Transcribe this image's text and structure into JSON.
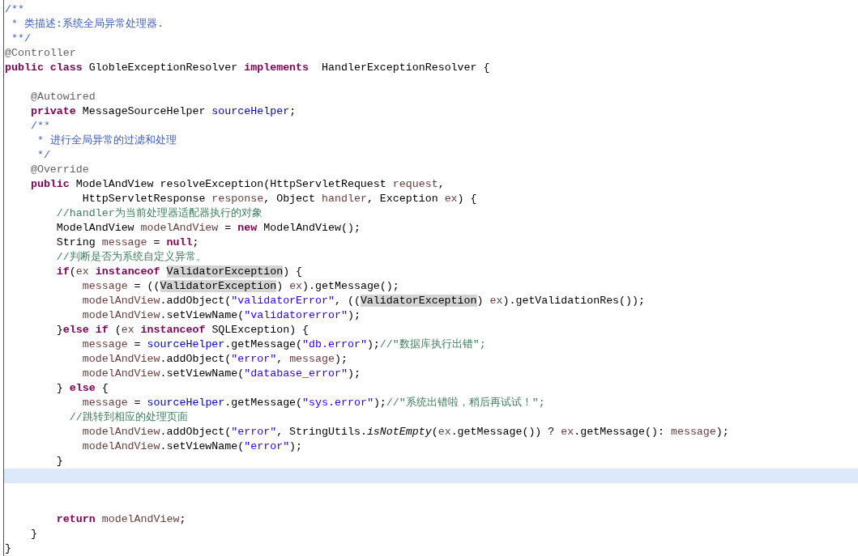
{
  "editor": {
    "lines": [
      {
        "current": false,
        "tokens": [
          {
            "kind": "doc",
            "text": "/**"
          }
        ]
      },
      {
        "current": false,
        "tokens": [
          {
            "kind": "doc",
            "text": " * 类描述:系统全局异常处理器."
          }
        ]
      },
      {
        "current": false,
        "tokens": [
          {
            "kind": "doc",
            "text": " **/"
          }
        ]
      },
      {
        "current": false,
        "tokens": [
          {
            "kind": "annotation",
            "text": "@Controller"
          }
        ]
      },
      {
        "current": false,
        "tokens": [
          {
            "kind": "keyword",
            "text": "public class"
          },
          {
            "kind": "plain",
            "text": " GlobleExceptionResolver "
          },
          {
            "kind": "keyword",
            "text": "implements"
          },
          {
            "kind": "plain",
            "text": "  HandlerExceptionResolver {"
          }
        ]
      },
      {
        "current": false
      },
      {
        "current": false,
        "tokens": [
          {
            "kind": "annotation",
            "text": "    @Autowired"
          }
        ]
      },
      {
        "current": false,
        "tokens": [
          {
            "kind": "keyword",
            "text": "    private"
          },
          {
            "kind": "plain",
            "text": " MessageSourceHelper "
          },
          {
            "kind": "field",
            "text": "sourceHelper"
          },
          {
            "kind": "plain",
            "text": ";"
          }
        ]
      },
      {
        "current": false,
        "tokens": [
          {
            "kind": "doc",
            "text": "    /**"
          }
        ]
      },
      {
        "current": false,
        "tokens": [
          {
            "kind": "doc",
            "text": "     * 进行全局异常的过滤和处理"
          }
        ]
      },
      {
        "current": false,
        "tokens": [
          {
            "kind": "doc",
            "text": "     */"
          }
        ]
      },
      {
        "current": false,
        "tokens": [
          {
            "kind": "annotation",
            "text": "    @Override"
          }
        ]
      },
      {
        "current": false,
        "tokens": [
          {
            "kind": "keyword",
            "text": "    public"
          },
          {
            "kind": "plain",
            "text": " ModelAndView resolveException(HttpServletRequest "
          },
          {
            "kind": "variable",
            "text": "request"
          },
          {
            "kind": "plain",
            "text": ","
          }
        ]
      },
      {
        "current": false,
        "tokens": [
          {
            "kind": "plain",
            "text": "            HttpServletResponse "
          },
          {
            "kind": "variable",
            "text": "response"
          },
          {
            "kind": "plain",
            "text": ", Object "
          },
          {
            "kind": "variable",
            "text": "handler"
          },
          {
            "kind": "plain",
            "text": ", Exception "
          },
          {
            "kind": "variable",
            "text": "ex"
          },
          {
            "kind": "plain",
            "text": ") {"
          }
        ]
      },
      {
        "current": false,
        "tokens": [
          {
            "kind": "comment",
            "text": "        //handler为当前处理器适配器执行的对象"
          }
        ]
      },
      {
        "current": false,
        "tokens": [
          {
            "kind": "plain",
            "text": "        ModelAndView "
          },
          {
            "kind": "variable",
            "text": "modelAndView"
          },
          {
            "kind": "plain",
            "text": " = "
          },
          {
            "kind": "keyword",
            "text": "new"
          },
          {
            "kind": "plain",
            "text": " ModelAndView();"
          }
        ]
      },
      {
        "current": false,
        "tokens": [
          {
            "kind": "plain",
            "text": "        String "
          },
          {
            "kind": "variable",
            "text": "message"
          },
          {
            "kind": "plain",
            "text": " = "
          },
          {
            "kind": "keyword",
            "text": "null"
          },
          {
            "kind": "plain",
            "text": ";"
          }
        ]
      },
      {
        "current": false,
        "tokens": [
          {
            "kind": "comment",
            "text": "        //判断是否为系统自定义异常。"
          }
        ]
      },
      {
        "current": false,
        "tokens": [
          {
            "kind": "keyword",
            "text": "        if"
          },
          {
            "kind": "plain",
            "text": "("
          },
          {
            "kind": "variable",
            "text": "ex"
          },
          {
            "kind": "keyword",
            "text": " instanceof "
          },
          {
            "kind": "occurrence",
            "text": "ValidatorException"
          },
          {
            "kind": "plain",
            "text": ") {"
          }
        ]
      },
      {
        "current": false,
        "tokens": [
          {
            "kind": "variable",
            "text": "            message"
          },
          {
            "kind": "plain",
            "text": " = (("
          },
          {
            "kind": "occurrence",
            "text": "ValidatorException"
          },
          {
            "kind": "plain",
            "text": ") "
          },
          {
            "kind": "variable",
            "text": "ex"
          },
          {
            "kind": "plain",
            "text": ").getMessage();"
          }
        ]
      },
      {
        "current": false,
        "tokens": [
          {
            "kind": "variable",
            "text": "            modelAndView"
          },
          {
            "kind": "plain",
            "text": ".addObject("
          },
          {
            "kind": "string",
            "text": "\"validatorError\""
          },
          {
            "kind": "plain",
            "text": ", (("
          },
          {
            "kind": "occurrence",
            "text": "ValidatorException"
          },
          {
            "kind": "plain",
            "text": ") "
          },
          {
            "kind": "variable",
            "text": "ex"
          },
          {
            "kind": "plain",
            "text": ").getValidationRes());"
          }
        ]
      },
      {
        "current": false,
        "tokens": [
          {
            "kind": "variable",
            "text": "            modelAndView"
          },
          {
            "kind": "plain",
            "text": ".setViewName("
          },
          {
            "kind": "string",
            "text": "\"validatorerror\""
          },
          {
            "kind": "plain",
            "text": ");"
          }
        ]
      },
      {
        "current": false,
        "tokens": [
          {
            "kind": "plain",
            "text": "        }"
          },
          {
            "kind": "keyword",
            "text": "else if"
          },
          {
            "kind": "plain",
            "text": " ("
          },
          {
            "kind": "variable",
            "text": "ex"
          },
          {
            "kind": "keyword",
            "text": " instanceof"
          },
          {
            "kind": "plain",
            "text": " SQLException) {"
          }
        ]
      },
      {
        "current": false,
        "tokens": [
          {
            "kind": "variable",
            "text": "            message"
          },
          {
            "kind": "plain",
            "text": " = "
          },
          {
            "kind": "field",
            "text": "sourceHelper"
          },
          {
            "kind": "plain",
            "text": ".getMessage("
          },
          {
            "kind": "string",
            "text": "\"db.error\""
          },
          {
            "kind": "plain",
            "text": ");"
          },
          {
            "kind": "comment",
            "text": "//\"数据库执行出错\";"
          }
        ]
      },
      {
        "current": false,
        "tokens": [
          {
            "kind": "variable",
            "text": "            modelAndView"
          },
          {
            "kind": "plain",
            "text": ".addObject("
          },
          {
            "kind": "string",
            "text": "\"error\""
          },
          {
            "kind": "plain",
            "text": ", "
          },
          {
            "kind": "variable",
            "text": "message"
          },
          {
            "kind": "plain",
            "text": ");"
          }
        ]
      },
      {
        "current": false,
        "tokens": [
          {
            "kind": "variable",
            "text": "            modelAndView"
          },
          {
            "kind": "plain",
            "text": ".setViewName("
          },
          {
            "kind": "string",
            "text": "\"database_error\""
          },
          {
            "kind": "plain",
            "text": ");"
          }
        ]
      },
      {
        "current": false,
        "tokens": [
          {
            "kind": "plain",
            "text": "        } "
          },
          {
            "kind": "keyword",
            "text": "else"
          },
          {
            "kind": "plain",
            "text": " {"
          }
        ]
      },
      {
        "current": false,
        "tokens": [
          {
            "kind": "variable",
            "text": "            message"
          },
          {
            "kind": "plain",
            "text": " = "
          },
          {
            "kind": "field",
            "text": "sourceHelper"
          },
          {
            "kind": "plain",
            "text": ".getMessage("
          },
          {
            "kind": "string",
            "text": "\"sys.error\""
          },
          {
            "kind": "plain",
            "text": ");"
          },
          {
            "kind": "comment",
            "text": "//\"系统出错啦，稍后再试试！\";"
          }
        ]
      },
      {
        "current": false,
        "tokens": [
          {
            "kind": "comment",
            "text": "          //跳转到相应的处理页面"
          }
        ]
      },
      {
        "current": false,
        "tokens": [
          {
            "kind": "variable",
            "text": "            modelAndView"
          },
          {
            "kind": "plain",
            "text": ".addObject("
          },
          {
            "kind": "string",
            "text": "\"error\""
          },
          {
            "kind": "plain",
            "text": ", StringUtils."
          },
          {
            "kind": "static",
            "text": "isNotEmpty"
          },
          {
            "kind": "plain",
            "text": "("
          },
          {
            "kind": "variable",
            "text": "ex"
          },
          {
            "kind": "plain",
            "text": ".getMessage()) ? "
          },
          {
            "kind": "variable",
            "text": "ex"
          },
          {
            "kind": "plain",
            "text": ".getMessage(): "
          },
          {
            "kind": "variable",
            "text": "message"
          },
          {
            "kind": "plain",
            "text": ");"
          }
        ]
      },
      {
        "current": false,
        "tokens": [
          {
            "kind": "variable",
            "text": "            modelAndView"
          },
          {
            "kind": "plain",
            "text": ".setViewName("
          },
          {
            "kind": "string",
            "text": "\"error\""
          },
          {
            "kind": "plain",
            "text": ");"
          }
        ]
      },
      {
        "current": false,
        "tokens": [
          {
            "kind": "plain",
            "text": "        }"
          }
        ]
      },
      {
        "current": true
      },
      {
        "current": false
      },
      {
        "current": false
      },
      {
        "current": false,
        "tokens": [
          {
            "kind": "keyword",
            "text": "        return "
          },
          {
            "kind": "variable",
            "text": "modelAndView"
          },
          {
            "kind": "plain",
            "text": ";"
          }
        ]
      },
      {
        "current": false,
        "tokens": [
          {
            "kind": "plain",
            "text": "    }"
          }
        ]
      },
      {
        "current": false,
        "tokens": [
          {
            "kind": "plain",
            "text": "}"
          }
        ]
      }
    ]
  }
}
